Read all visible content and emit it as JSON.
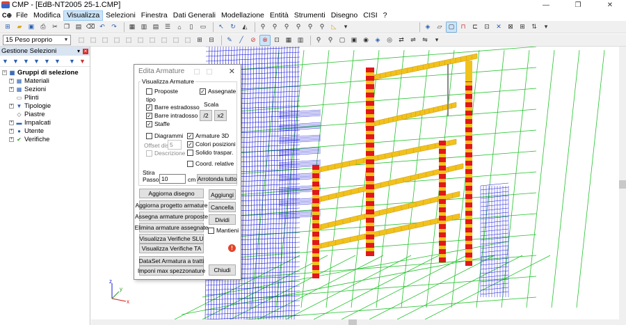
{
  "window": {
    "title": "CMP - [EdB-NT2005 25-1.CMP]",
    "controls": [
      "—",
      "❐",
      "✕"
    ]
  },
  "menu": {
    "app_glyph": "C⊕",
    "items": [
      "File",
      "Modifica",
      "Visualizza",
      "Selezioni",
      "Finestra",
      "Dati Generali",
      "Modellazione",
      "Entità",
      "Strumenti",
      "Disegno",
      "CISI",
      "?"
    ],
    "active": "Visualizza"
  },
  "toolbar": {
    "load_case": "15 Peso proprio"
  },
  "left_panel": {
    "title": "Gestione Selezioni",
    "tree": {
      "root": "Gruppi di selezione",
      "items": [
        {
          "label": "Materiali",
          "icon": "materials-icon",
          "expandable": true
        },
        {
          "label": "Sezioni",
          "icon": "sections-icon",
          "expandable": true
        },
        {
          "label": "Plinti",
          "icon": "footings-icon",
          "expandable": false
        },
        {
          "label": "Tipologie",
          "icon": "typologies-icon",
          "expandable": true
        },
        {
          "label": "Piastre",
          "icon": "plates-icon",
          "expandable": false
        },
        {
          "label": "Impalcati",
          "icon": "floors-icon",
          "expandable": true
        },
        {
          "label": "Utente",
          "icon": "user-icon",
          "expandable": true
        },
        {
          "label": "Verifiche",
          "icon": "checks-icon",
          "expandable": true
        }
      ]
    }
  },
  "dialog": {
    "title": "Edita Armature",
    "group_label": "Visualizza Armature",
    "proposte": {
      "label": "Proposte",
      "checked": false
    },
    "assegnate": {
      "label": "Assegnate",
      "checked": true
    },
    "tipo_label": "tipo",
    "barre_estradosso": {
      "label": "Barre estradosso",
      "checked": true
    },
    "barre_intradosso": {
      "label": "Barre intradosso",
      "checked": true
    },
    "staffe": {
      "label": "Staffe",
      "checked": true
    },
    "scala_label": "Scala",
    "scala_div": "/2",
    "scala_mul": "x2",
    "diagrammi": {
      "label": "Diagrammi",
      "checked": false
    },
    "armature_3d": {
      "label": "Armature 3D",
      "checked": true
    },
    "offset_label": "Offset dis.",
    "offset_value": "5",
    "colori_posizioni": {
      "label": "Colori posizioni",
      "checked": true
    },
    "descrizione": {
      "label": "Descrizione",
      "checked": false
    },
    "solido_traspar": {
      "label": "Solido traspar.",
      "checked": false
    },
    "coord_relative": {
      "label": "Coord. relative",
      "checked": false
    },
    "stira_label": "Stira",
    "passo_label": "Passo",
    "passo_value": "10",
    "passo_unit": "cm",
    "arrotonda_tutto": "Arrotonda tutto",
    "aggiorna_disegno": "Aggiorna disegno",
    "aggiungi": "Aggiungi",
    "aggiorna_progetto": "Aggiorna progetto armature",
    "cancella": "Cancella",
    "assegna_proposte": "Assegna armature proposte",
    "dividi": "Dividi",
    "elimina_assegnate": "Elimina armature assegnate",
    "mantieni": {
      "label": "Mantieni",
      "checked": false
    },
    "verifiche_slu": "Visualizza Verifiche SLU",
    "verifiche_ta": "Visualizza Verifiche TA",
    "dataset_tratti": "DataSet Armatura a tratti",
    "imponi_spezzonature": "Imponi max spezzonature",
    "chiudi": "Chiudi"
  },
  "axes": {
    "x": "x",
    "y": "y",
    "z": "z"
  },
  "colors": {
    "grid_green": "#22c22a",
    "mesh_blue": "#1a1ad8",
    "beam_red": "#e01818",
    "beam_yellow": "#f2c21c",
    "menu_highlight": "#cce4f7"
  }
}
